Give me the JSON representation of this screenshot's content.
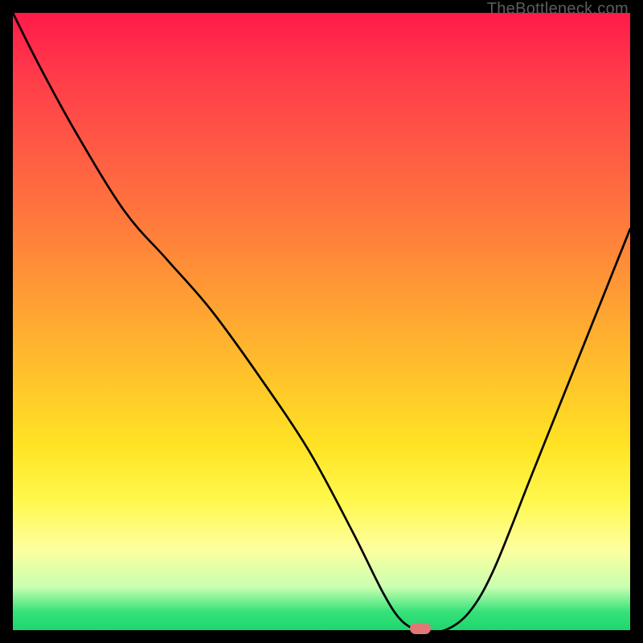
{
  "watermark": "TheBottleneck.com",
  "chart_data": {
    "type": "line",
    "title": "",
    "xlabel": "",
    "ylabel": "",
    "xlim": [
      0,
      100
    ],
    "ylim": [
      0,
      100
    ],
    "grid": false,
    "legend": false,
    "background_gradient": {
      "type": "vertical_rainbow",
      "top_color": "#ff1a4a",
      "bottom_color": "#1fd66e"
    },
    "series": [
      {
        "name": "bottleneck-curve",
        "color": "#000000",
        "x": [
          0,
          4,
          10,
          18,
          25,
          32,
          40,
          48,
          55,
          60,
          63,
          66,
          70,
          74,
          78,
          84,
          90,
          96,
          100
        ],
        "y": [
          100,
          92,
          81,
          68,
          60,
          52,
          41,
          29,
          16,
          6,
          1.5,
          0,
          0,
          3,
          10,
          25,
          40,
          55,
          65
        ]
      }
    ],
    "marker": {
      "name": "optimal-point",
      "x": 66,
      "y": 0,
      "color": "#e07878"
    }
  }
}
